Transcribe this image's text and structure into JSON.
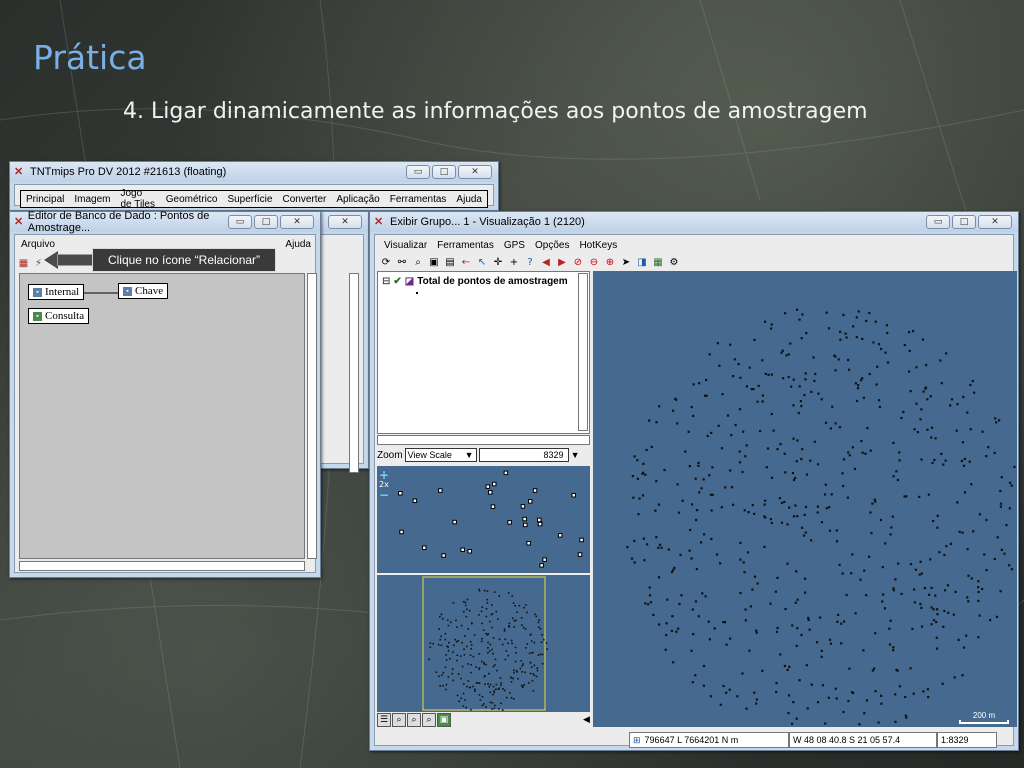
{
  "slide": {
    "title": "Prática",
    "subtitle": "4. Ligar dinamicamente as informações aos pontos de amostragem"
  },
  "tnt_window": {
    "title": "TNTmips Pro DV 2012  #21613 (floating)",
    "menu": [
      "Principal",
      "Imagem",
      "Jogo de Tiles",
      "Geométrico",
      "Superfície",
      "Converter",
      "Aplicação",
      "Ferramentas",
      "Ajuda"
    ]
  },
  "db_editor": {
    "title": "Editor de Banco de Dado : Pontos de Amostrage...",
    "menu_left": "Arquivo",
    "menu_right": "Ajuda",
    "nodes": {
      "internal": "Internal",
      "chave": "Chave",
      "consulta": "Consulta"
    }
  },
  "callout": {
    "text": "Clique no ícone “Relacionar”"
  },
  "vis_window": {
    "title": "Exibir Grupo... 1 - Visualização 1 (2120)",
    "menu": [
      "Visualizar",
      "Ferramentas",
      "GPS",
      "Opções",
      "HotKeys"
    ],
    "layer_name": "Total de pontos de amostragem",
    "zoom_label": "Zoom",
    "zoom_mode": "View Scale",
    "zoom_value": "8329",
    "overview_zoom": "2x",
    "scalebar_label": "200 m",
    "status": {
      "coords": "796647 L  7664201 N m",
      "latlon": "W 48 08 40.8  S 21 05 57.4",
      "scale": "1:8329"
    }
  },
  "colors": {
    "map_background": "#46698f",
    "title_accent": "#7ab0e8"
  }
}
